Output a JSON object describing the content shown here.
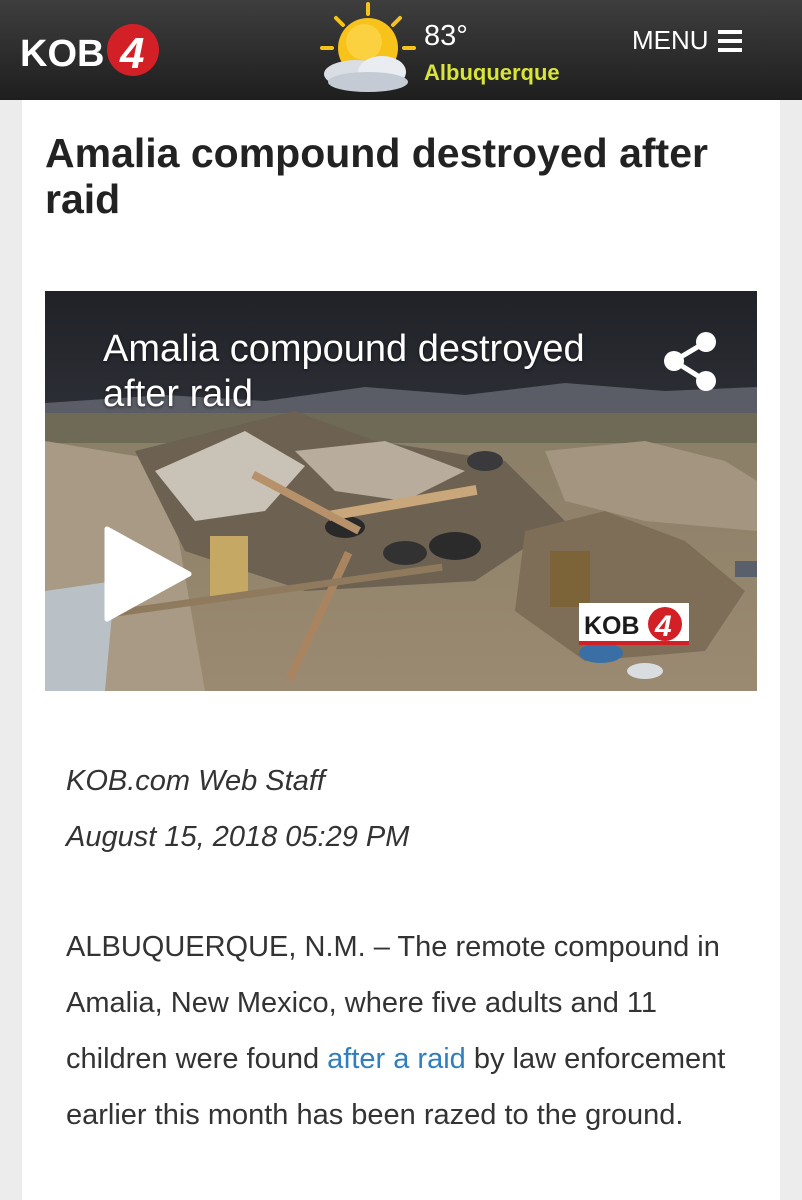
{
  "header": {
    "logo_text": "KOB",
    "logo_number": "4",
    "weather_icon": "partly-sunny-icon",
    "temperature": "83°",
    "city": "Albuquerque",
    "menu_label": "MENU",
    "menu_icon": "hamburger-icon"
  },
  "article": {
    "headline": "Amalia compound destroyed after raid",
    "video": {
      "title": "Amalia compound destroyed after raid",
      "share_icon": "share-icon",
      "play_icon": "play-icon",
      "watermark_text": "KOB",
      "watermark_number": "4"
    },
    "byline": "KOB.com Web Staff",
    "date": "August 15, 2018 05:29 PM",
    "body": {
      "before_link": "ALBUQUERQUE, N.M. – The remote compound in Amalia, New Mexico, where five adults and 11 children were found ",
      "link_text": "after a raid",
      "after_link": " by law enforcement earlier this month has been razed to the ground."
    }
  },
  "colors": {
    "header_bg": "#2c2c2c",
    "city_text": "#d8e437",
    "logo_red": "#d32027",
    "link": "#2f7fc0"
  }
}
